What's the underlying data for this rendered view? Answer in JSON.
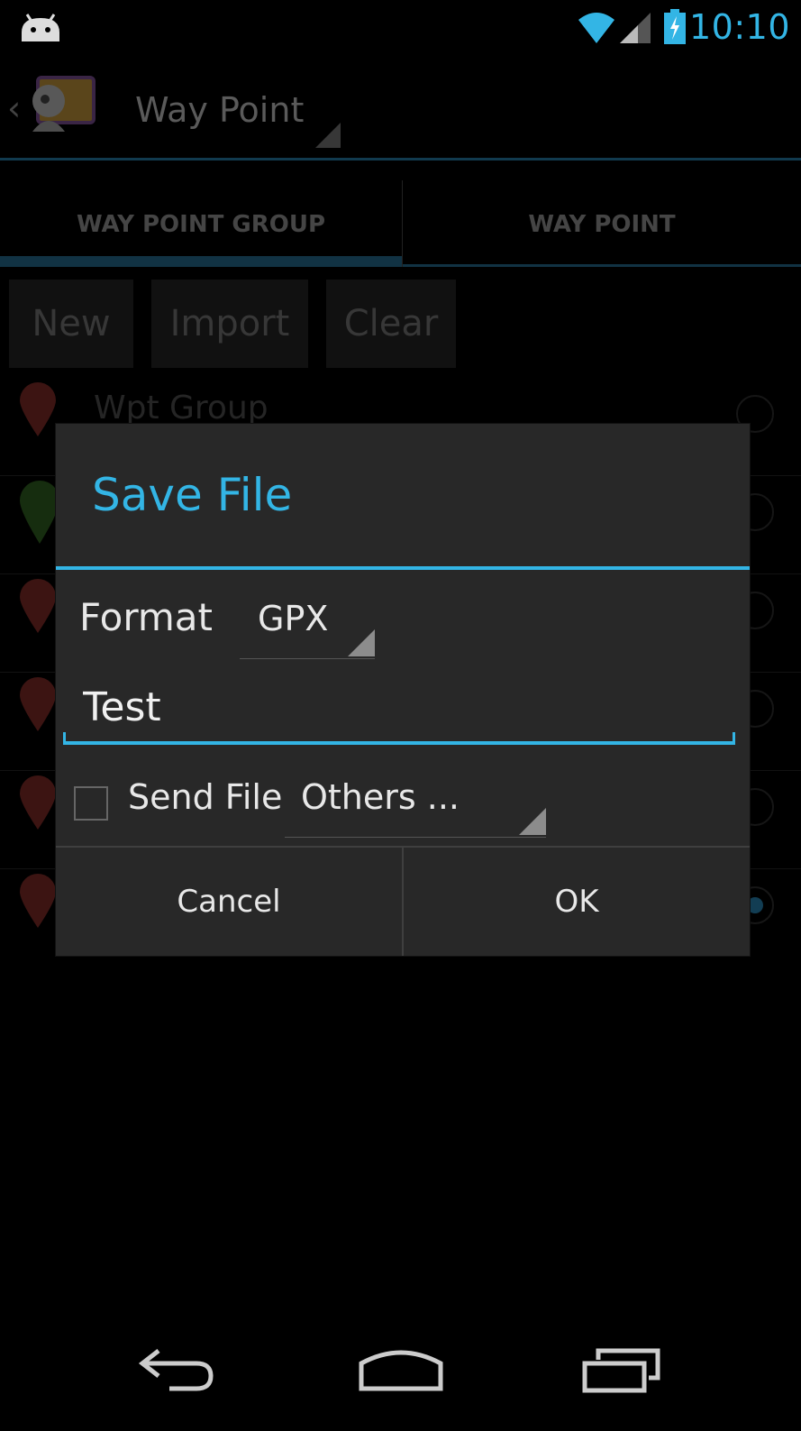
{
  "status_bar": {
    "time": "10:10",
    "icons": [
      "android-debug-icon",
      "wifi-icon",
      "signal-icon",
      "battery-charging-icon"
    ]
  },
  "action_bar": {
    "title": "Way Point",
    "icons": [
      "back-caret-icon",
      "app-icon",
      "spinner-triangle-icon"
    ]
  },
  "tabs": [
    {
      "label": "WAY POINT GROUP",
      "selected": true
    },
    {
      "label": "WAY POINT",
      "selected": false
    }
  ],
  "toolbar": {
    "new_label": "New",
    "import_label": "Import",
    "clear_label": "Clear"
  },
  "list": {
    "first_item_label": "Wpt Group",
    "rows": [
      {
        "pin_color": "#7a2a26",
        "selected": false
      },
      {
        "pin_color": "#2f5b1e",
        "selected": false
      },
      {
        "pin_color": "#7a2a26",
        "selected": false
      },
      {
        "pin_color": "#7a2a26",
        "selected": false
      },
      {
        "pin_color": "#7a2a26",
        "selected": false
      },
      {
        "pin_color": "#7a2a26",
        "selected": true
      }
    ]
  },
  "dialog": {
    "title": "Save File",
    "format_label": "Format",
    "format_value": "GPX",
    "filename_value": "Test",
    "send_file_label": "Send File",
    "send_file_checked": false,
    "send_target_value": "Others ...",
    "cancel_label": "Cancel",
    "ok_label": "OK"
  },
  "nav_bar": {
    "icons": [
      "back-icon",
      "home-icon",
      "recent-apps-icon"
    ]
  },
  "colors": {
    "accent": "#33b5e5",
    "dialog_bg": "#282828",
    "background": "#000000"
  }
}
